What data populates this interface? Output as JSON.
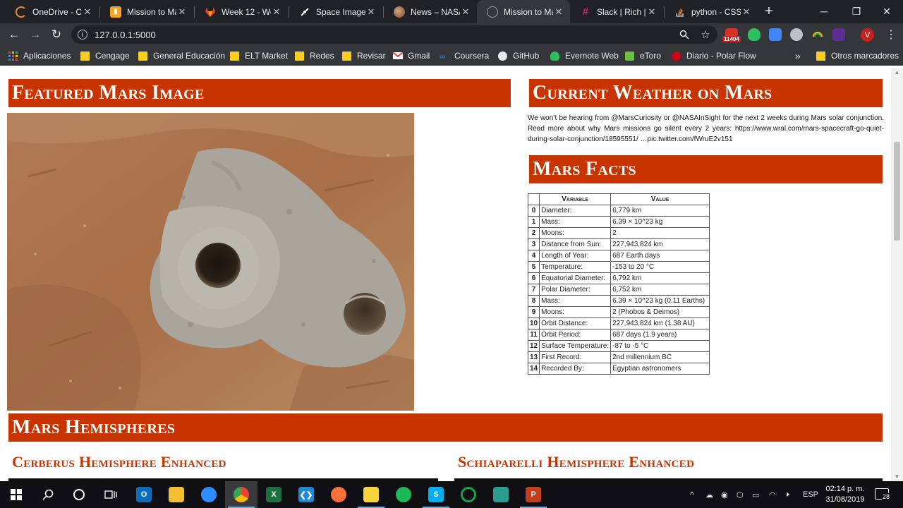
{
  "tabs": [
    {
      "title": "OneDrive - Ce",
      "icon": "onedrive-spinner-icon",
      "color": "#f28c28"
    },
    {
      "title": "Mission to Ma",
      "icon": "jupyter-notebook-icon",
      "color": "#f5a623"
    },
    {
      "title": "Week 12 - Wel",
      "icon": "gitlab-icon",
      "color": "#e24329"
    },
    {
      "title": "Space Images",
      "icon": "space-images-icon",
      "color": "#ffffff"
    },
    {
      "title": "News – NASA",
      "icon": "nasa-globe-icon",
      "color": "#b07a4f"
    },
    {
      "title": "Mission to Ma",
      "icon": "page-globe-icon",
      "color": "#9aa0a6",
      "active": true
    },
    {
      "title": "Slack | Rich | D",
      "icon": "slack-icon",
      "color": "#611f69"
    },
    {
      "title": "python - CSS",
      "icon": "stackoverflow-icon",
      "color": "#f48024"
    }
  ],
  "toolbar": {
    "url": "127.0.0.1:5000",
    "mail_badge": "11404",
    "profile_initial": "V"
  },
  "bookmarks": [
    {
      "label": "Aplicaciones",
      "icon": "apps-grid-icon"
    },
    {
      "label": "Cengage",
      "icon": "folder-icon"
    },
    {
      "label": "General Educación",
      "icon": "folder-icon"
    },
    {
      "label": "ELT Market",
      "icon": "folder-icon"
    },
    {
      "label": "Redes",
      "icon": "folder-icon"
    },
    {
      "label": "Revisar",
      "icon": "folder-icon"
    },
    {
      "label": "Gmail",
      "icon": "gmail-icon"
    },
    {
      "label": "Coursera",
      "icon": "coursera-icon"
    },
    {
      "label": "GitHub",
      "icon": "github-icon"
    },
    {
      "label": "Evernote Web",
      "icon": "evernote-icon"
    },
    {
      "label": "eToro",
      "icon": "etoro-icon"
    },
    {
      "label": "Diario - Polar Flow",
      "icon": "polar-icon"
    }
  ],
  "bookmarks_overflow": "»",
  "other_bookmarks": "Otros marcadores",
  "page": {
    "featured_title": "Featured Mars Image",
    "weather_title": "Current Weather on Mars",
    "weather_text": "We won’t be hearing from @MarsCuriosity or @NASAInSight for the next 2 weeks during Mars solar conjunction. Read more about why Mars missions go silent every 2 years: https://www.wral.com/mars-spacecraft-go-quiet-during-solar-conjunction/18595551/ …pic.twitter.com/fWruE2v151",
    "facts_title": "Mars Facts",
    "hemispheres_title": "Mars Hemispheres",
    "hemi_1": "Cerberus Hemisphere Enhanced",
    "hemi_2": "Schiaparelli Hemisphere Enhanced"
  },
  "facts_table": {
    "headers": [
      "Variable",
      "Value"
    ],
    "rows": [
      {
        "index": "0",
        "variable": "Diameter:",
        "value": "6,779 km"
      },
      {
        "index": "1",
        "variable": "Mass:",
        "value": "6.39 × 10^23 kg"
      },
      {
        "index": "2",
        "variable": "Moons:",
        "value": "2"
      },
      {
        "index": "3",
        "variable": "Distance from Sun:",
        "value": "227,943,824 km"
      },
      {
        "index": "4",
        "variable": "Length of Year:",
        "value": "687 Earth days"
      },
      {
        "index": "5",
        "variable": "Temperature:",
        "value": "-153 to 20 °C"
      },
      {
        "index": "6",
        "variable": "Equatorial Diameter:",
        "value": "6,792 km"
      },
      {
        "index": "7",
        "variable": "Polar Diameter:",
        "value": "6,752 km"
      },
      {
        "index": "8",
        "variable": "Mass:",
        "value": "6.39 × 10^23 kg (0.11 Earths)"
      },
      {
        "index": "9",
        "variable": "Moons:",
        "value": "2 (Phobos & Deimos)"
      },
      {
        "index": "10",
        "variable": "Orbit Distance:",
        "value": "227,943,824 km (1.38 AU)"
      },
      {
        "index": "11",
        "variable": "Orbit Period:",
        "value": "687 days (1.9 years)"
      },
      {
        "index": "12",
        "variable": "Surface Temperature:",
        "value": "-87 to -5 °C"
      },
      {
        "index": "13",
        "variable": "First Record:",
        "value": "2nd millennium BC"
      },
      {
        "index": "14",
        "variable": "Recorded By:",
        "value": "Egyptian astronomers"
      }
    ]
  },
  "taskbar": {
    "apps": [
      {
        "name": "start",
        "icon": "windows-start-icon"
      },
      {
        "name": "search",
        "icon": "search-icon"
      },
      {
        "name": "cortana",
        "icon": "cortana-circle-icon"
      },
      {
        "name": "task-view",
        "icon": "task-view-icon"
      },
      {
        "name": "outlook",
        "icon": "outlook-icon",
        "color": "#0f6cbd",
        "glyph": "O"
      },
      {
        "name": "file-explorer",
        "icon": "file-explorer-icon",
        "color": "#f3c033",
        "glyph": ""
      },
      {
        "name": "zoom",
        "icon": "zoom-icon",
        "color": "#2d8cff",
        "glyph": ""
      },
      {
        "name": "chrome",
        "icon": "chrome-icon",
        "color": "#34a853",
        "glyph": "",
        "running": true,
        "active": true
      },
      {
        "name": "excel",
        "icon": "excel-icon",
        "color": "#1d6f42",
        "glyph": "X"
      },
      {
        "name": "vscode",
        "icon": "vscode-icon",
        "color": "#1f8ad2",
        "glyph": "❮❯"
      },
      {
        "name": "firefox",
        "icon": "firefox-icon",
        "color": "#ff7139",
        "glyph": ""
      },
      {
        "name": "sticky-notes",
        "icon": "sticky-notes-icon",
        "color": "#f7d33d",
        "glyph": "",
        "running": true
      },
      {
        "name": "spotify",
        "icon": "spotify-icon",
        "color": "#1db954",
        "glyph": ""
      },
      {
        "name": "skype",
        "icon": "skype-icon",
        "color": "#00aff0",
        "glyph": "S",
        "running": true
      },
      {
        "name": "app-green-ring",
        "icon": "green-ring-icon",
        "color": "#17a34a",
        "glyph": ""
      },
      {
        "name": "gitkraken",
        "icon": "gitkraken-icon",
        "color": "#2a9d8f",
        "glyph": ""
      },
      {
        "name": "powerpoint",
        "icon": "powerpoint-icon",
        "color": "#c43e1c",
        "glyph": "P",
        "running": true
      }
    ],
    "lang": "ESP",
    "time": "02:14 p. m.",
    "date": "31/08/2019",
    "notifications": "28"
  }
}
